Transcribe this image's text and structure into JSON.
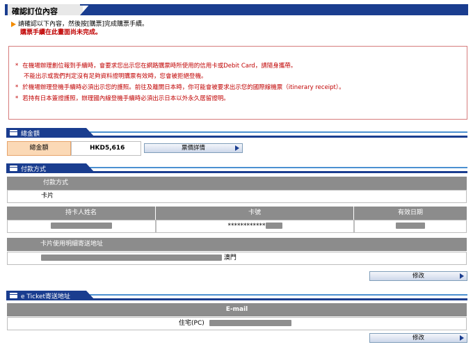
{
  "header": {
    "title": "確認訂位內容",
    "instruction": "請確認以下內容，然後按[購票]完成購票手續。",
    "warning": "購票手續在此畫面尚未完成。"
  },
  "notice": {
    "lines": [
      {
        "star": "*",
        "text": "在機場辦理劃位報到手續時，會要求您出示您在網路購票時所使用的信用卡或Debit Card，請隨身攜帶。"
      },
      {
        "star": "",
        "text": "不能出示或我們判定沒有足夠資料證明購票有效時，您會被拒絕登機。"
      },
      {
        "star": "*",
        "text": "於機場辦理登機手續時必須出示您的護照。前往及離開日本時，你可能會被要求出示您的國際線機票（itinerary receipt）。"
      },
      {
        "star": "*",
        "text": "若持有日本簽證護照，辦理國內線登機手續時必須出示日本以外永久居留證明。"
      }
    ]
  },
  "total_section": {
    "header": "總金額",
    "label": "總金額",
    "amount": "HKD5,616",
    "detail_button": "票價詳情"
  },
  "payment_section": {
    "header": "付款方式",
    "method_header": "付款方式",
    "method_value": "卡片",
    "columns": [
      "持卡人姓名",
      "卡號",
      "有效日期"
    ],
    "card_number_visible": "************",
    "address_header": "卡片使用明細寄送地址",
    "address_suffix": "澳門",
    "edit_button": "修改"
  },
  "eticket_section": {
    "header": "e Ticket寄送地址",
    "email_header": "E-mail",
    "home_label": "住宅(PC)",
    "edit_button": "修改"
  },
  "colors": {
    "brand_blue": "#1a3d8f",
    "accent_light_blue": "#4a90d0",
    "warning_red": "#c00000",
    "arrow_orange": "#f28c00",
    "total_bg": "#fbd9b6",
    "table_header": "#8c8c8c"
  }
}
